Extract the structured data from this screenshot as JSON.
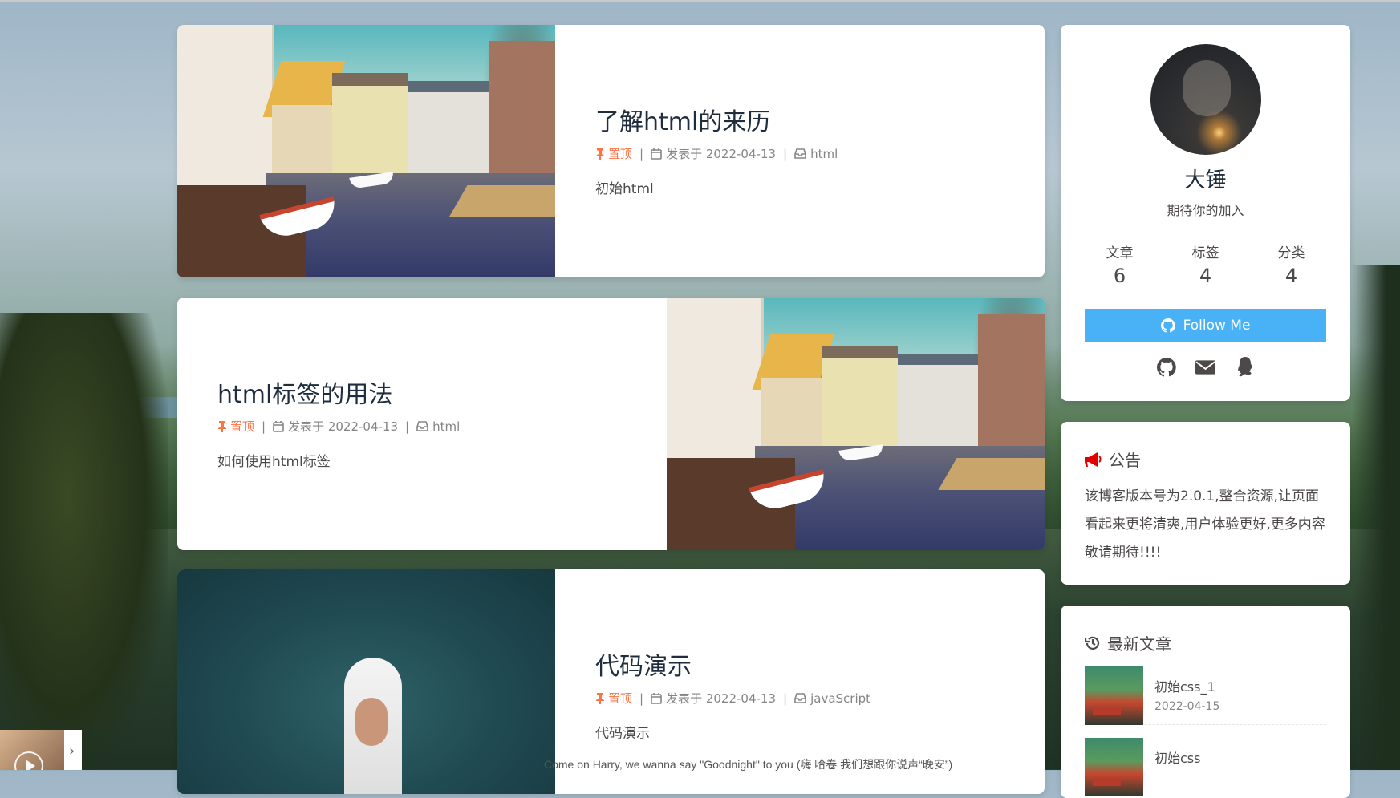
{
  "posts": [
    {
      "title": "了解html的来历",
      "sticky": "置顶",
      "date": "发表于 2022-04-13",
      "category": "html",
      "desc": "初始html"
    },
    {
      "title": "html标签的用法",
      "sticky": "置顶",
      "date": "发表于 2022-04-13",
      "category": "html",
      "desc": "如何使用html标签"
    },
    {
      "title": "代码演示",
      "sticky": "置顶",
      "date": "发表于 2022-04-13",
      "category": "javaScript",
      "desc": "代码演示"
    }
  ],
  "author": {
    "name": "大锤",
    "description": "期待你的加入",
    "stats": [
      {
        "label": "文章",
        "value": "6"
      },
      {
        "label": "标签",
        "value": "4"
      },
      {
        "label": "分类",
        "value": "4"
      }
    ],
    "follow_label": "Follow Me"
  },
  "notice": {
    "title": "公告",
    "text": "该博客版本号为2.0.1,整合资源,让页面看起来更将清爽,用户体验更好,更多内容敬请期待!!!!"
  },
  "recent": {
    "title": "最新文章",
    "items": [
      {
        "title": "初始css_1",
        "date": "2022-04-15"
      },
      {
        "title": "初始css",
        "date": ""
      }
    ]
  },
  "player": {
    "lyric": "Come on Harry, we wanna say \"Goodnight\" to you (嗨 哈卷 我们想跟你说声“晚安”)"
  },
  "colors": {
    "accent": "#49b1f5",
    "sticky": "#ff7242",
    "notice_icon": "#e00000"
  }
}
